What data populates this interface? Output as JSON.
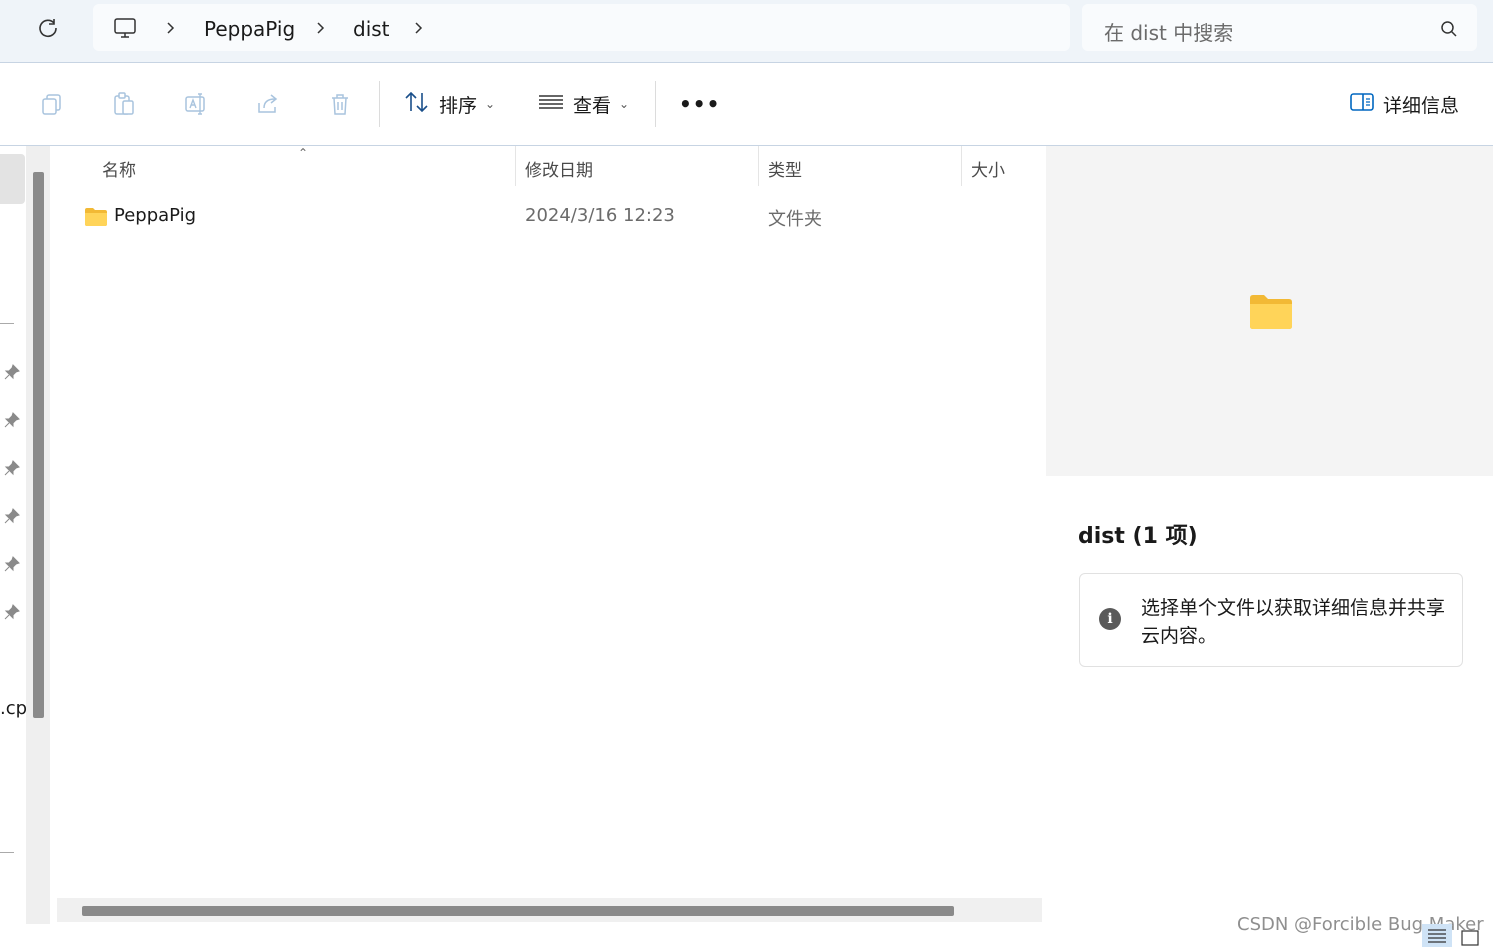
{
  "address_bar": {
    "refresh_icon": "refresh-icon",
    "computer_icon": "computer-icon",
    "breadcrumbs": [
      "PeppaPig",
      "dist"
    ],
    "search_placeholder": "在 dist 中搜索",
    "search_icon": "search-icon"
  },
  "toolbar": {
    "icons": [
      "copy-icon",
      "paste-icon",
      "rename-icon",
      "share-icon",
      "delete-icon"
    ],
    "sort_label": "排序",
    "view_label": "查看",
    "more_label": "•••",
    "details_label": "详细信息"
  },
  "nav": {
    "partial_text": ".cp"
  },
  "file_list": {
    "columns": {
      "name": "名称",
      "modified": "修改日期",
      "type": "类型",
      "size": "大小"
    },
    "rows": [
      {
        "name": "PeppaPig",
        "modified": "2024/3/16 12:23",
        "type": "文件夹",
        "size": ""
      }
    ]
  },
  "details_pane": {
    "title": "dist (1 项)",
    "info_text": "选择单个文件以获取详细信息并共享云内容。"
  },
  "watermark": "CSDN @Forcible Bug Maker",
  "colors": {
    "folder_yellow": "#ffcf48",
    "accent_blue": "#0067c0",
    "scroll_thumb": "#8a8a8a"
  }
}
